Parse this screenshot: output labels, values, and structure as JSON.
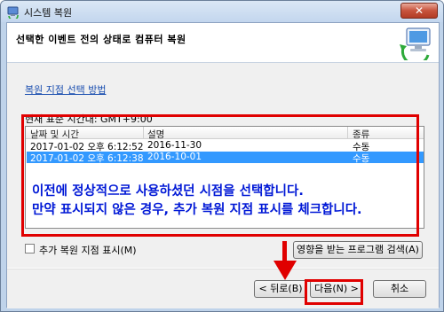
{
  "window": {
    "title": "시스템 복원",
    "close_glyph": "✕"
  },
  "header": {
    "title": "선택한 이벤트 전의 상태로 컴퓨터 복원"
  },
  "main": {
    "help_link": "복원 지점 선택 방법",
    "timezone_label": "현재 표준 시간대: GMT+9:00",
    "list": {
      "columns": [
        "날짜 및 시간",
        "설명",
        "종류"
      ],
      "rows": [
        {
          "date": "2017-01-02 오후 6:12:52",
          "description": "2016-11-30",
          "type": "수동",
          "selected": false
        },
        {
          "date": "2017-01-02 오후 6:12:38",
          "description": "2016-10-01",
          "type": "수동",
          "selected": true
        }
      ]
    },
    "show_more_label": "추가 복원 지점 표시(M)",
    "scan_button": "영향을 받는 프로그램 검색(A)"
  },
  "annotation": {
    "line1": "이전에 정상적으로 사용하셨던 시점을 선택합니다.",
    "line2": "만약 표시되지 않은 경우, 추가 복원 지점 표시를 체크합니다.",
    "color": "#e00000",
    "text_color": "#0018d6"
  },
  "footer": {
    "back_button": "< 뒤로(B)",
    "next_button": "다음(N) >",
    "cancel_button": "취소"
  }
}
